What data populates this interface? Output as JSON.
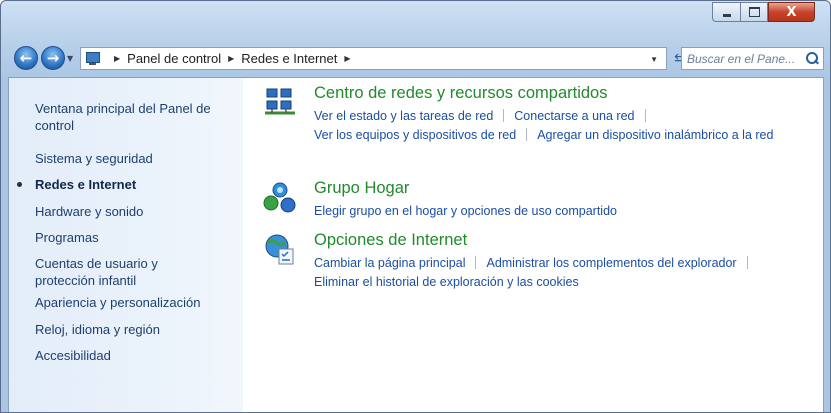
{
  "window": {
    "minimize_glyph": "",
    "close_glyph": "X"
  },
  "nav": {
    "back_glyph": "←",
    "forward_glyph": "→",
    "breadcrumbs": [
      "Panel de control",
      "Redes e Internet"
    ],
    "search_placeholder": "Buscar en el Pane..."
  },
  "sidebar": {
    "items": [
      {
        "label": "Ventana principal del Panel de control"
      },
      {
        "label": "Sistema y seguridad"
      },
      {
        "label": "Redes e Internet",
        "active": true
      },
      {
        "label": "Hardware y sonido"
      },
      {
        "label": "Programas"
      },
      {
        "label": "Cuentas de usuario y protección infantil"
      },
      {
        "label": "Apariencia y personalización"
      },
      {
        "label": "Reloj, idioma y región"
      },
      {
        "label": "Accesibilidad"
      }
    ]
  },
  "sections": [
    {
      "title": "Centro de redes y recursos compartidos",
      "icon": "network-center-icon",
      "links": [
        [
          "Ver el estado y las tareas de red",
          "Conectarse a una red"
        ],
        [
          "Ver los equipos y dispositivos de red",
          "Agregar un dispositivo inalámbrico a la red"
        ]
      ]
    },
    {
      "title": "Grupo Hogar",
      "icon": "homegroup-icon",
      "links": [
        [
          "Elegir grupo en el hogar y opciones de uso compartido"
        ]
      ]
    },
    {
      "title": "Opciones de Internet",
      "icon": "internet-options-icon",
      "links": [
        [
          "Cambiar la página principal",
          "Administrar los complementos del explorador"
        ],
        [
          "Eliminar el historial de exploración y las cookies"
        ]
      ]
    }
  ],
  "colors": {
    "link": "#1b4ea3",
    "section_title": "#218a2c",
    "sidebar_text": "#1e3f6e"
  }
}
